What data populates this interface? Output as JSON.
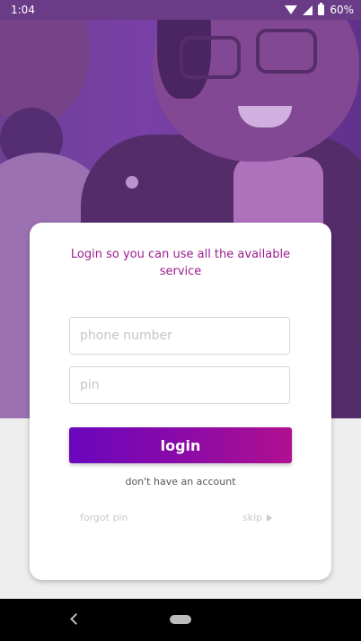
{
  "status_bar": {
    "time": "1:04",
    "battery": "60%"
  },
  "login_card": {
    "title": "Login so you can use all the available service",
    "phone_placeholder": "phone number",
    "pin_placeholder": "pin",
    "login_label": "login",
    "no_account_label": "don't have an account",
    "forgot_pin_label": "forgot pin",
    "skip_label": "skip"
  },
  "colors": {
    "accent": "#9c1b8f",
    "button_gradient_start": "#6a06be",
    "button_gradient_end": "#b0108f"
  },
  "icons": [
    "wifi-icon",
    "signal-icon",
    "battery-icon",
    "play-icon",
    "back-icon",
    "home-icon"
  ]
}
